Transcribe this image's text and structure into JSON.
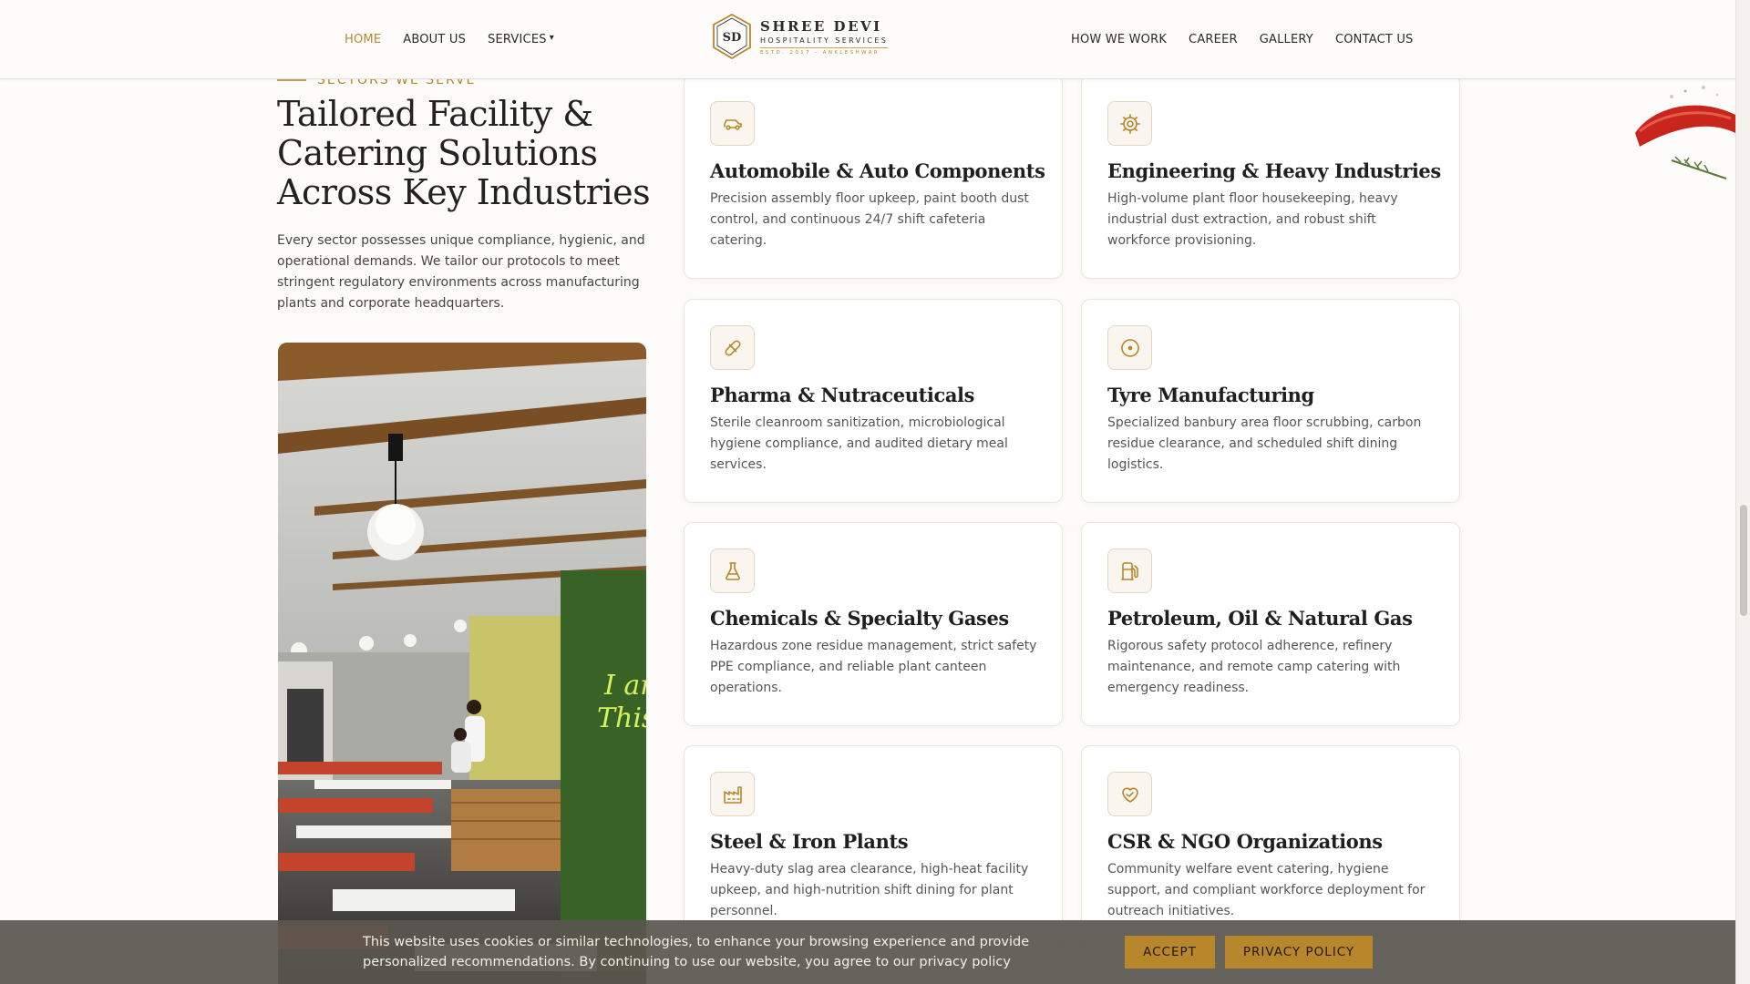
{
  "nav": {
    "left": [
      {
        "label": "HOME",
        "active": true
      },
      {
        "label": "ABOUT US"
      },
      {
        "label": "SERVICES",
        "caret": "▾"
      }
    ],
    "right": [
      {
        "label": "HOW WE WORK"
      },
      {
        "label": "CAREER"
      },
      {
        "label": "GALLERY"
      },
      {
        "label": "CONTACT US"
      }
    ]
  },
  "logo": {
    "monogram": "SD",
    "title": "SHREE DEVI",
    "subtitle": "HOSPITALITY SERVICES",
    "estd": "ESTD. 2017 - ANKLESHWAR"
  },
  "section": {
    "eyebrow": "SECTORS WE SERVE",
    "headline": "Tailored Facility & Catering Solutions Across Key Industries",
    "intro": "Every sector possesses unique compliance, hygienic, and operational demands. We tailor our protocols to meet stringent regulatory environments across manufacturing plants and corporate headquarters."
  },
  "photo": {
    "signage": [
      "I am",
      "This is"
    ]
  },
  "cards": [
    {
      "icon": "car-icon",
      "title": "Automobile & Auto Components",
      "desc": "Precision assembly floor upkeep, paint booth dust control, and continuous 24/7 shift cafeteria catering."
    },
    {
      "icon": "cog-icon",
      "title": "Engineering & Heavy Industries",
      "desc": "High-volume plant floor housekeeping, heavy industrial dust extraction, and robust shift workforce provisioning."
    },
    {
      "icon": "pill-icon",
      "title": "Pharma & Nutraceuticals",
      "desc": "Sterile cleanroom sanitization, microbiological hygiene compliance, and audited dietary meal services."
    },
    {
      "icon": "tyre-icon",
      "title": "Tyre Manufacturing",
      "desc": "Specialized banbury area floor scrubbing, carbon residue clearance, and scheduled shift dining logistics."
    },
    {
      "icon": "flask-icon",
      "title": "Chemicals & Specialty Gases",
      "desc": "Hazardous zone residue management, strict safety PPE compliance, and reliable plant canteen operations."
    },
    {
      "icon": "fuel-pump-icon",
      "title": "Petroleum, Oil & Natural Gas",
      "desc": "Rigorous safety protocol adherence, refinery maintenance, and remote camp catering with emergency readiness."
    },
    {
      "icon": "factory-icon",
      "title": "Steel & Iron Plants",
      "desc": "Heavy-duty slag area clearance, high-heat facility upkeep, and high-nutrition shift dining for plant personnel."
    },
    {
      "icon": "hand-heart-icon",
      "title": "CSR & NGO Organizations",
      "desc": "Community welfare event catering, hygiene support, and compliant workforce deployment for outreach initiatives."
    }
  ],
  "cookie": {
    "text": "This website uses cookies or similar technologies, to enhance your browsing experience and provide personalized recommendations. By continuing to use our website, you agree to our privacy policy",
    "accept": "ACCEPT",
    "privacy": "PRIVACY POLICY"
  },
  "colors": {
    "accent": "#b8862b",
    "background": "#fdfcfa",
    "card_border": "#ebe6dc",
    "cookie_bar": "#5a5650"
  }
}
